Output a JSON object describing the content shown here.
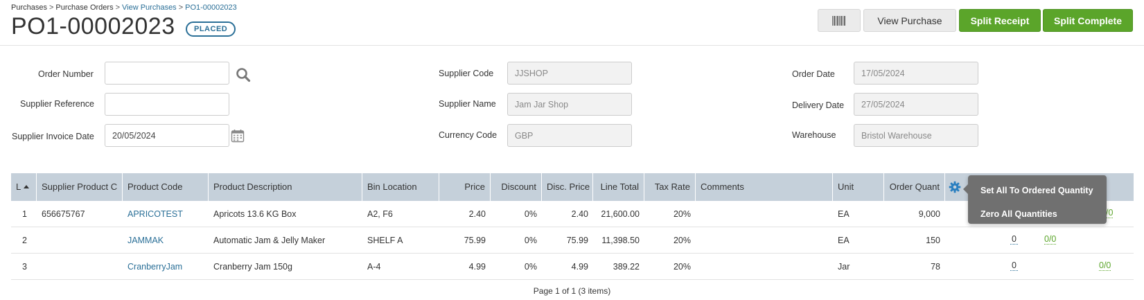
{
  "breadcrumb": {
    "items": [
      "Purchases",
      "Purchase Orders",
      "View Purchases",
      "PO1-00002023"
    ]
  },
  "page": {
    "title": "PO1-00002023",
    "status": "PLACED"
  },
  "toolbar": {
    "barcode_icon": "barcode-icon",
    "view_purchase_label": "View Purchase",
    "split_receipt_label": "Split Receipt",
    "split_complete_label": "Split Complete"
  },
  "form": {
    "order_number": {
      "label": "Order Number",
      "value": ""
    },
    "supplier_reference": {
      "label": "Supplier Reference",
      "value": ""
    },
    "supplier_invoice_date": {
      "label": "Supplier Invoice Date",
      "value": "20/05/2024"
    },
    "supplier_code": {
      "label": "Supplier Code",
      "value": "JJSHOP"
    },
    "supplier_name": {
      "label": "Supplier Name",
      "value": "Jam Jar Shop"
    },
    "currency_code": {
      "label": "Currency Code",
      "value": "GBP"
    },
    "order_date": {
      "label": "Order Date",
      "value": "17/05/2024"
    },
    "delivery_date": {
      "label": "Delivery Date",
      "value": "27/05/2024"
    },
    "warehouse": {
      "label": "Warehouse",
      "value": "Bristol Warehouse"
    }
  },
  "grid": {
    "columns": [
      "L",
      "Supplier Product C",
      "Product Code",
      "Product Description",
      "Bin Location",
      "Price",
      "Discount",
      "Disc. Price",
      "Line Total",
      "Tax Rate",
      "Comments",
      "Unit",
      "Order Quant"
    ],
    "rows": [
      {
        "line": "1",
        "supplier_product_code": "656675767",
        "product_code": "APRICOTEST",
        "description": "Apricots 13.6 KG Box",
        "bin": "A2, F6",
        "price": "2.40",
        "discount": "0%",
        "disc_price": "2.40",
        "line_total": "21,600.00",
        "tax_rate": "20%",
        "comments": "",
        "unit": "EA",
        "order_qty": "9,000",
        "received": "",
        "ratio": "/0"
      },
      {
        "line": "2",
        "supplier_product_code": "",
        "product_code": "JAMMAK",
        "description": "Automatic Jam & Jelly Maker",
        "bin": "SHELF A",
        "price": "75.99",
        "discount": "0%",
        "disc_price": "75.99",
        "line_total": "11,398.50",
        "tax_rate": "20%",
        "comments": "",
        "unit": "EA",
        "order_qty": "150",
        "received": "0",
        "ratio": "0/0"
      },
      {
        "line": "3",
        "supplier_product_code": "",
        "product_code": "CranberryJam",
        "description": "Cranberry Jam 150g",
        "bin": "A-4",
        "price": "4.99",
        "discount": "0%",
        "disc_price": "4.99",
        "line_total": "389.22",
        "tax_rate": "20%",
        "comments": "",
        "unit": "Jar",
        "order_qty": "78",
        "received": "0",
        "ratio": "0/0"
      }
    ]
  },
  "quantity_menu": {
    "items": [
      "Set All To Ordered Quantity",
      "Zero All Quantities"
    ]
  },
  "pager": {
    "text": "Page 1 of 1 (3 items)"
  },
  "colors": {
    "accent_blue": "#2a6f97",
    "green_button": "#5ba52a",
    "header_bg": "#c5d0da",
    "dropdown_bg": "#707070"
  }
}
